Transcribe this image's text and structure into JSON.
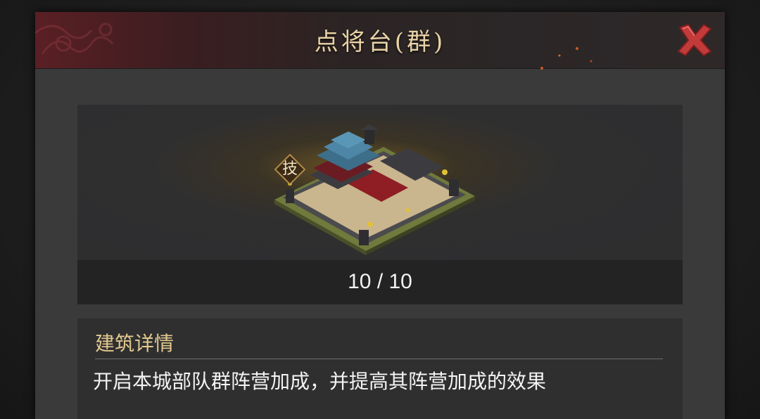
{
  "dialog": {
    "title": "点将台(群)",
    "close_icon": "close-x-icon"
  },
  "building": {
    "badge_label": "技",
    "level_text": "10 / 10"
  },
  "details": {
    "heading": "建筑详情",
    "description": "开启本城部队群阵营加成，并提高其阵营加成的效果"
  },
  "colors": {
    "title_text": "#e9d3a6",
    "close_icon": "#c23a3a",
    "heading_gold": "#e3c98f",
    "panel_bg": "#3a3a3b"
  }
}
